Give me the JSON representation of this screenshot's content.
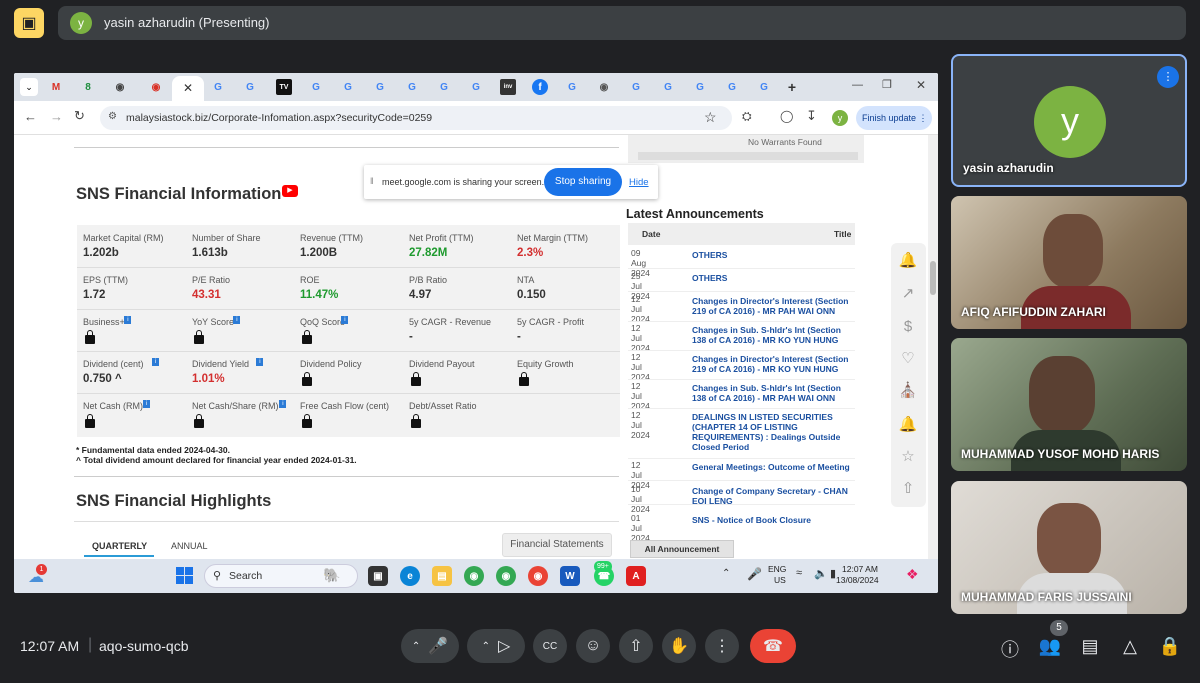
{
  "meet": {
    "presenter_label": "yasin azharudin (Presenting)",
    "presenter_initial": "y",
    "time": "12:07 AM",
    "meeting_code": "aqo-sumo-qcb",
    "people_count": "5",
    "participants": [
      {
        "name": "yasin azharudin",
        "initial": "y"
      },
      {
        "name": "AFIQ AFIFUDDIN ZAHARI"
      },
      {
        "name": "MUHAMMAD YUSOF MOHD HARIS"
      },
      {
        "name": "MUHAMMAD FARIS JUSSAINI"
      }
    ]
  },
  "browser": {
    "url": "malaysiastock.biz/Corporate-Infomation.aspx?securityCode=0259",
    "finish_update": "Finish update",
    "profile_initial": "y"
  },
  "share_banner": {
    "text": "meet.google.com is sharing your screen.",
    "stop": "Stop sharing",
    "hide": "Hide"
  },
  "page": {
    "no_warrants": "No Warrants Found",
    "fin_title": "SNS Financial Information",
    "rows": [
      [
        {
          "label": "Market Capital (RM)",
          "value": "1.202b"
        },
        {
          "label": "Number of Share",
          "value": "1.613b"
        },
        {
          "label": "Revenue (TTM)",
          "value": "1.200B"
        },
        {
          "label": "Net Profit (TTM)",
          "value": "27.82M",
          "color": "#1e9a2e"
        },
        {
          "label": "Net Margin (TTM)",
          "value": "2.3%",
          "color": "#d32f2f"
        }
      ],
      [
        {
          "label": "EPS (TTM)",
          "value": "1.72"
        },
        {
          "label": "P/E Ratio",
          "value": "43.31",
          "color": "#d32f2f"
        },
        {
          "label": "ROE",
          "value": "11.47%",
          "color": "#1e9a2e"
        },
        {
          "label": "P/B Ratio",
          "value": "4.97"
        },
        {
          "label": "NTA",
          "value": "0.150"
        }
      ],
      [
        {
          "label": "Business+",
          "lock": true
        },
        {
          "label": "YoY Score",
          "lock": true
        },
        {
          "label": "QoQ Score",
          "lock": true
        },
        {
          "label": "5y CAGR - Revenue",
          "value": "-"
        },
        {
          "label": "5y CAGR - Profit",
          "value": "-"
        }
      ],
      [
        {
          "label": "Dividend (cent)",
          "value": "0.750 ^"
        },
        {
          "label": "Dividend Yield",
          "value": "1.01%",
          "color": "#d32f2f"
        },
        {
          "label": "Dividend Policy",
          "lock": true
        },
        {
          "label": "Dividend Payout",
          "lock": true
        },
        {
          "label": "Equity Growth",
          "lock": true
        }
      ],
      [
        {
          "label": "Net Cash (RM)",
          "lock": true
        },
        {
          "label": "Net Cash/Share (RM)",
          "lock": true
        },
        {
          "label": "Free Cash Flow (cent)",
          "lock": true
        },
        {
          "label": "Debt/Asset Ratio",
          "lock": true
        },
        {
          "label": ""
        }
      ]
    ],
    "note1": "* Fundamental data ended 2024-04-30.",
    "note2": "^ Total dividend amount declared for financial year ended 2024-01-31.",
    "highlights_title": "SNS Financial Highlights",
    "tab_quarterly": "QUARTERLY",
    "tab_annual": "ANNUAL",
    "fin_statements": "Financial Statements",
    "latest_title": "Latest Announcements",
    "ann_head_date": "Date",
    "ann_head_title": "Title",
    "announcements": [
      {
        "date": "09 Aug 2024",
        "title": "OTHERS"
      },
      {
        "date": "25 Jul 2024",
        "title": "OTHERS"
      },
      {
        "date": "12 Jul 2024",
        "title": "Changes in Director's Interest (Section 219 of CA 2016) - MR PAH WAI ONN"
      },
      {
        "date": "12 Jul 2024",
        "title": "Changes in Sub. S-hldr's Int (Section 138 of CA 2016) - MR KO YUN HUNG"
      },
      {
        "date": "12 Jul 2024",
        "title": "Changes in Director's Interest (Section 219 of CA 2016) - MR KO YUN HUNG"
      },
      {
        "date": "12 Jul 2024",
        "title": "Changes in Sub. S-hldr's Int (Section 138 of CA 2016) - MR PAH WAI ONN"
      },
      {
        "date": "12 Jul 2024",
        "title": "DEALINGS IN LISTED SECURITIES (CHAPTER 14 OF LISTING REQUIREMENTS) : Dealings Outside Closed Period"
      },
      {
        "date": "12 Jul 2024",
        "title": "General Meetings: Outcome of Meeting"
      },
      {
        "date": "10 Jul 2024",
        "title": "Change of Company Secretary - CHAN EOI LENG"
      },
      {
        "date": "01 Jul 2024",
        "title": "SNS - Notice of Book Closure"
      }
    ],
    "all_ann": "All Announcement"
  },
  "taskbar": {
    "search": "Search",
    "lang1": "ENG",
    "lang2": "US",
    "time": "12:07 AM",
    "date": "13/08/2024",
    "badge": "99+",
    "weather_badge": "1"
  }
}
